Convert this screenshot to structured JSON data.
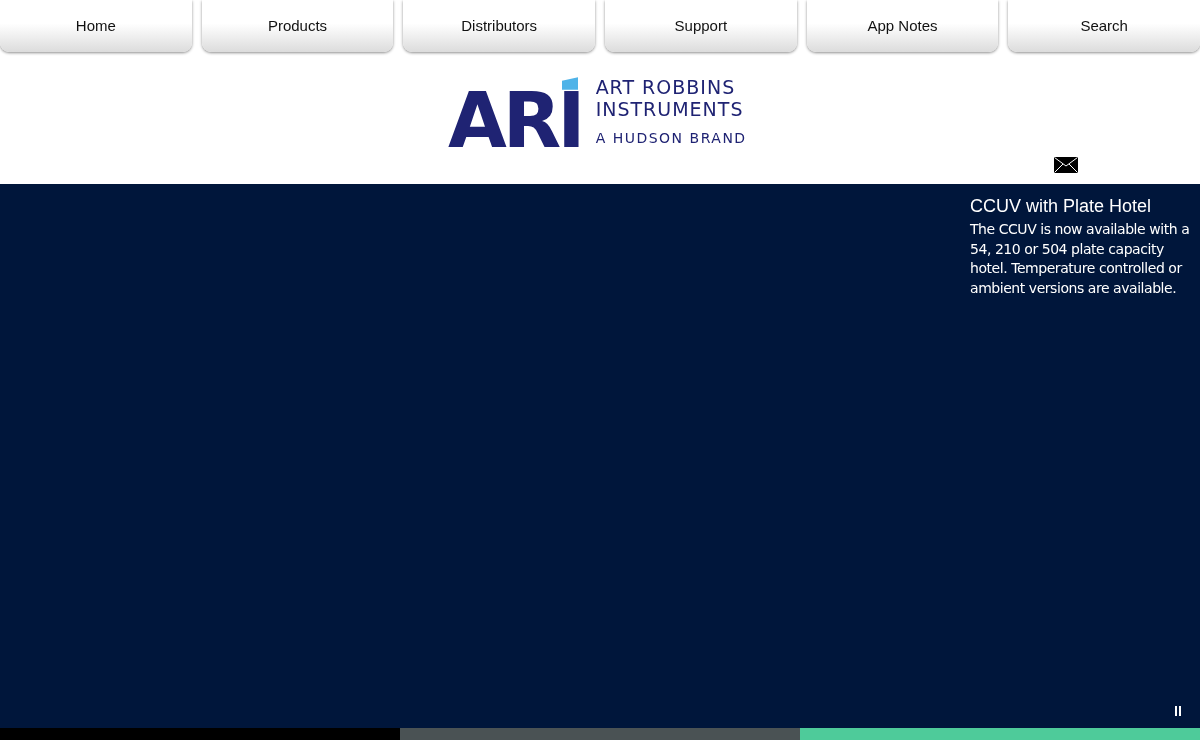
{
  "nav": [
    {
      "label": "Home"
    },
    {
      "label": "Products"
    },
    {
      "label": "Distributors"
    },
    {
      "label": "Support"
    },
    {
      "label": "App Notes"
    },
    {
      "label": "Search"
    }
  ],
  "logo": {
    "mark": "ARI",
    "name_line_1": "ART ROBBINS",
    "name_line_2": "INSTRUMENTS",
    "tagline": "A HUDSON BRAND"
  },
  "slide": {
    "title": "CCUV with Plate Hotel",
    "text": "The CCUV is now available with a 54, 210 or 504 plate capacity hotel. Temperature controlled or ambient versions are available."
  },
  "slide_indicators": [
    {
      "color": "#000000"
    },
    {
      "color": "#4a5254"
    },
    {
      "color": "#4ecb9a"
    }
  ]
}
